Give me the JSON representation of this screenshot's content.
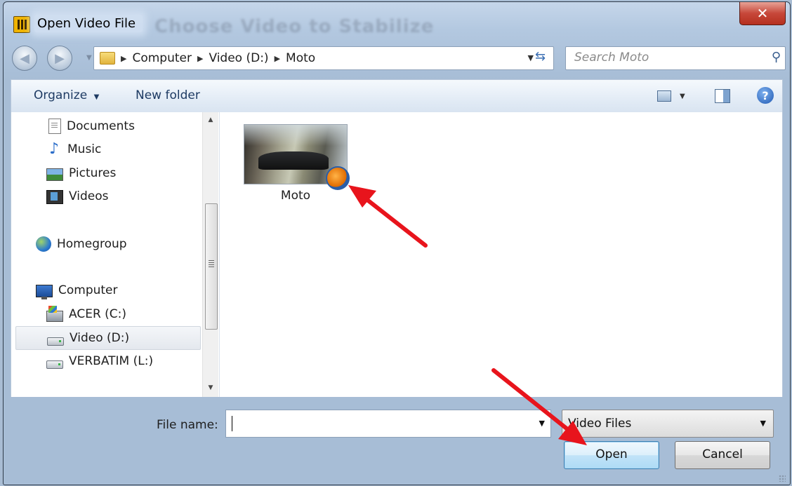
{
  "window": {
    "title": "Open Video File",
    "background_title": "Choose Video to Stabilize",
    "close_glyph": "✕"
  },
  "address_bar": {
    "breadcrumbs": [
      "Computer",
      "Video (D:)",
      "Moto"
    ]
  },
  "search": {
    "placeholder": "Search Moto"
  },
  "toolbar": {
    "organize_label": "Organize",
    "new_folder_label": "New folder"
  },
  "sidebar": {
    "items": [
      {
        "label": "Documents",
        "icon": "documents-icon"
      },
      {
        "label": "Music",
        "icon": "music-icon"
      },
      {
        "label": "Pictures",
        "icon": "pictures-icon"
      },
      {
        "label": "Videos",
        "icon": "videos-icon"
      },
      {
        "label": "Homegroup",
        "icon": "homegroup-icon"
      },
      {
        "label": "Computer",
        "icon": "computer-icon"
      },
      {
        "label": "ACER (C:)",
        "icon": "drive-c-icon"
      },
      {
        "label": "Video (D:)",
        "icon": "drive-icon",
        "selected": true
      },
      {
        "label": "VERBATIM (L:)",
        "icon": "drive-icon"
      }
    ]
  },
  "files": [
    {
      "name": "Moto",
      "icon": "video-folder-icon"
    }
  ],
  "bottom": {
    "file_name_label": "File name:",
    "file_name_value": "",
    "file_type_value": "Video Files",
    "open_label": "Open",
    "cancel_label": "Cancel"
  },
  "colors": {
    "annotation_arrow": "#e8141c",
    "selected_item_bg": "#e4e8ee",
    "default_button_border": "#3c7fb1"
  }
}
